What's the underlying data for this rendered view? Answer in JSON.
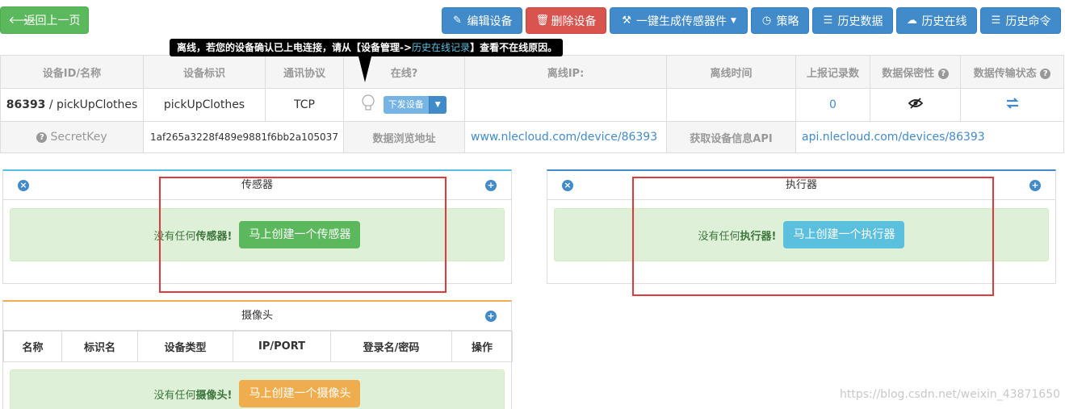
{
  "toolbar": {
    "back_label": "返回上一页",
    "edit_label": "编辑设备",
    "delete_label": "删除设备",
    "generate_label": "一键生成传感器件",
    "strategy_label": "策略",
    "history_data_label": "历史数据",
    "history_online_label": "历史在线",
    "history_command_label": "历史命令"
  },
  "tooltip": {
    "prefix": "离线，若您的设备确认已上电连接，请从【设备管理->",
    "link": "历史在线记录",
    "suffix": "】查看不在线原因。"
  },
  "info_table": {
    "headers": {
      "device_id_name": "设备ID/名称",
      "device_tag": "设备标识",
      "protocol": "通讯协议",
      "online": "在线?",
      "offline_ip": "离线IP:",
      "offline_time": "离线时间",
      "report_count": "上报记录数",
      "data_privacy": "数据保密性",
      "transfer_status": "数据传输状态"
    },
    "device_id": "86393",
    "device_name": "/ pickUpClothes",
    "device_tag": "pickUpClothes",
    "protocol": "TCP",
    "send_button": "下发设备",
    "offline_ip": "",
    "offline_time": "",
    "report_count": "0",
    "secret_key_label": "SecretKey",
    "secret_key": "1af265a3228f489e9881f6bb2a105037",
    "browse_label": "数据浏览地址",
    "browse_url": "www.nlecloud.com/device/86393",
    "api_label": "获取设备信息API",
    "api_url": "api.nlecloud.com/devices/86393"
  },
  "sensor_panel": {
    "title": "传感器",
    "empty_prefix": "没有任何",
    "empty_bold": "传感器!",
    "create_button": "马上创建一个传感器"
  },
  "actuator_panel": {
    "title": "执行器",
    "empty_prefix": "没有任何",
    "empty_bold": "执行器!",
    "create_button": "马上创建一个执行器"
  },
  "camera_panel": {
    "title": "摄像头",
    "columns": [
      "名称",
      "标识名",
      "设备类型",
      "IP/PORT",
      "登录名/密码",
      "操作"
    ],
    "empty_prefix": "没有任何",
    "empty_bold": "摄像头!",
    "create_button": "马上创建一个摄像头"
  },
  "watermark": "https://blog.csdn.net/weixin_43871650",
  "colors": {
    "primary": "#428bca",
    "success": "#5cb85c",
    "danger": "#d9534f",
    "info": "#5bc0de",
    "warning": "#f0ad4e",
    "highlight_box": "#e1393c"
  }
}
